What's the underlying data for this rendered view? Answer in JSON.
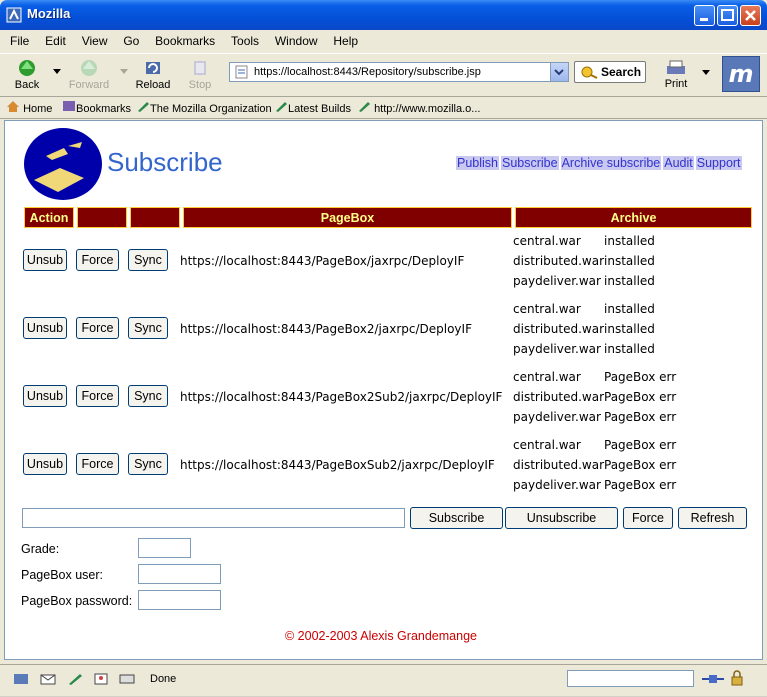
{
  "window": {
    "title": "Mozilla"
  },
  "menu": [
    "File",
    "Edit",
    "View",
    "Go",
    "Bookmarks",
    "Tools",
    "Window",
    "Help"
  ],
  "nav": {
    "back": "Back",
    "forward": "Forward",
    "reload": "Reload",
    "stop": "Stop",
    "url": "https://localhost:8443/Repository/subscribe.jsp",
    "search": "Search",
    "print": "Print",
    "logo": "m"
  },
  "bookmarks": [
    "Home",
    "Bookmarks",
    "The Mozilla Organization",
    "Latest Builds",
    "http://www.mozilla.o..."
  ],
  "page": {
    "title": "Subscribe",
    "links": [
      "Publish",
      "Subscribe",
      "Archive subscribe",
      "Audit",
      "Support"
    ],
    "headers": {
      "action": "Action",
      "pagebox": "PageBox",
      "archive": "Archive"
    },
    "row_buttons": {
      "unsub": "Unsub",
      "force": "Force",
      "sync": "Sync"
    },
    "rows": [
      {
        "url": "https://localhost:8443/PageBox/jaxrpc/DeployIF",
        "archives": [
          {
            "name": "central.war",
            "status": "installed"
          },
          {
            "name": "distributed.war",
            "status": "installed"
          },
          {
            "name": "paydeliver.war",
            "status": "installed"
          }
        ]
      },
      {
        "url": "https://localhost:8443/PageBox2/jaxrpc/DeployIF",
        "archives": [
          {
            "name": "central.war",
            "status": "installed"
          },
          {
            "name": "distributed.war",
            "status": "installed"
          },
          {
            "name": "paydeliver.war",
            "status": "installed"
          }
        ]
      },
      {
        "url": "https://localhost:8443/PageBox2Sub2/jaxrpc/DeployIF",
        "archives": [
          {
            "name": "central.war",
            "status": "PageBox err"
          },
          {
            "name": "distributed.war",
            "status": "PageBox err"
          },
          {
            "name": "paydeliver.war",
            "status": "PageBox err"
          }
        ]
      },
      {
        "url": "https://localhost:8443/PageBoxSub2/jaxrpc/DeployIF",
        "archives": [
          {
            "name": "central.war",
            "status": "PageBox err"
          },
          {
            "name": "distributed.war",
            "status": "PageBox err"
          },
          {
            "name": "paydeliver.war",
            "status": "PageBox err"
          }
        ]
      }
    ],
    "form": {
      "url_value": "",
      "subscribe": "Subscribe",
      "unsubscribe": "Unsubscribe",
      "force": "Force",
      "refresh": "Refresh",
      "grade_label": "Grade:",
      "grade_value": "",
      "user_label": "PageBox user:",
      "user_value": "",
      "password_label": "PageBox password:",
      "password_value": ""
    },
    "copyright": "© 2002-2003 Alexis Grandemange"
  },
  "status": {
    "text": "Done"
  }
}
